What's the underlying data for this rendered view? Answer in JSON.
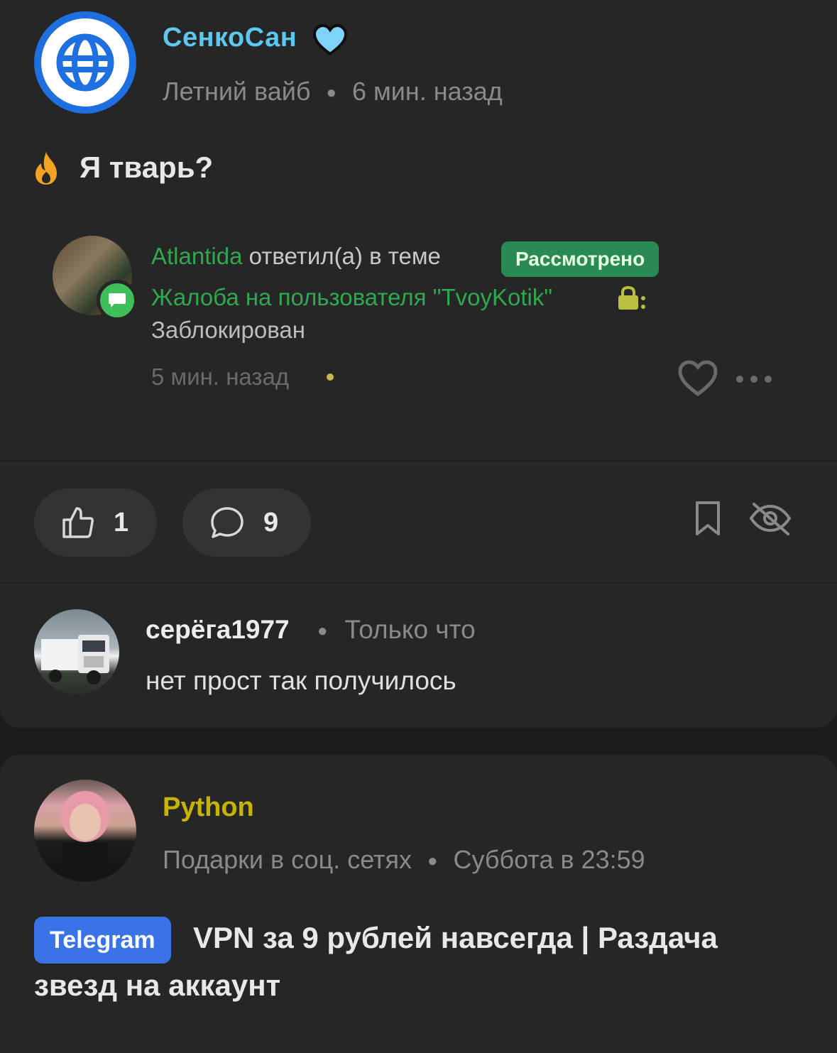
{
  "post1": {
    "author": "СенкоСан",
    "section": "Летний вайб",
    "time": "6 мин. назад",
    "title": "Я тварь?",
    "embed": {
      "user": "Atlantida",
      "action": " ответил(а) в теме",
      "status": "Рассмотрено",
      "thread": "Жалоба на пользователя \"TvoyKotik\"",
      "suffix": ":",
      "result": "Заблокирован",
      "time": "5 мин. назад"
    },
    "likes": "1",
    "comments": "9"
  },
  "comment": {
    "author": "серёга1977",
    "time": "Только что",
    "text": "нет прост так получилось"
  },
  "post2": {
    "author": "Python",
    "section": "Подарки в соц. сетях",
    "time": "Суббота в 23:59",
    "tag": "Telegram",
    "title_line1": "VPN за 9 рублей навсегда | Раздача",
    "title_line2": "звезд на аккаунт"
  },
  "colors": {
    "background": "#1c1c1c",
    "card": "#262626",
    "author1": "#5cc8f0",
    "author3": "#c8b400",
    "green": "#2fa84f",
    "tag": "#3a72e8"
  },
  "icons": [
    "globe-icon",
    "heart-badge-icon",
    "flame-icon",
    "message-badge-icon",
    "lock-icon",
    "heart-icon",
    "more-icon",
    "thumbs-up-icon",
    "comment-icon",
    "bookmark-icon",
    "eye-off-icon"
  ]
}
